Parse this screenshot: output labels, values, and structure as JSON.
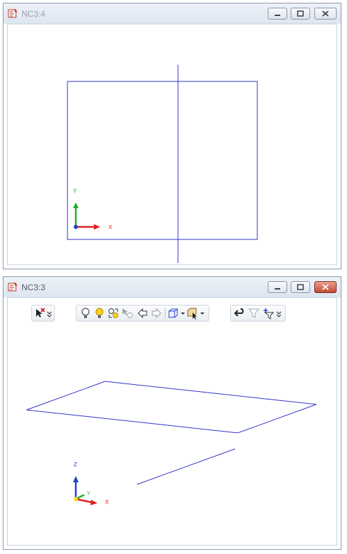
{
  "top_window": {
    "title": "NC3:4",
    "axis_labels": {
      "x": "X",
      "y": "Y"
    }
  },
  "bottom_window": {
    "title": "NC3:3",
    "axis_labels": {
      "x": "X",
      "y": "Y",
      "z": "Z"
    },
    "toolbar_icons": [
      "select-cross-icon",
      "more-chevron-icon",
      "bulb-off-icon",
      "bulb-on-icon",
      "bulb-swap-icon",
      "pointer-bulb-icon",
      "arrow-left-icon",
      "arrow-right-icon",
      "box-view-icon",
      "dropdown-caret-icon",
      "box-select-icon",
      "dropdown-caret-icon",
      "undo-icon",
      "filter-icon",
      "filter-axis-icon",
      "more-chevron-icon"
    ]
  },
  "colors": {
    "geometry": "#3333cc",
    "x_axis": "#e02020",
    "y_axis": "#20b020",
    "z_axis": "#2040d0"
  }
}
